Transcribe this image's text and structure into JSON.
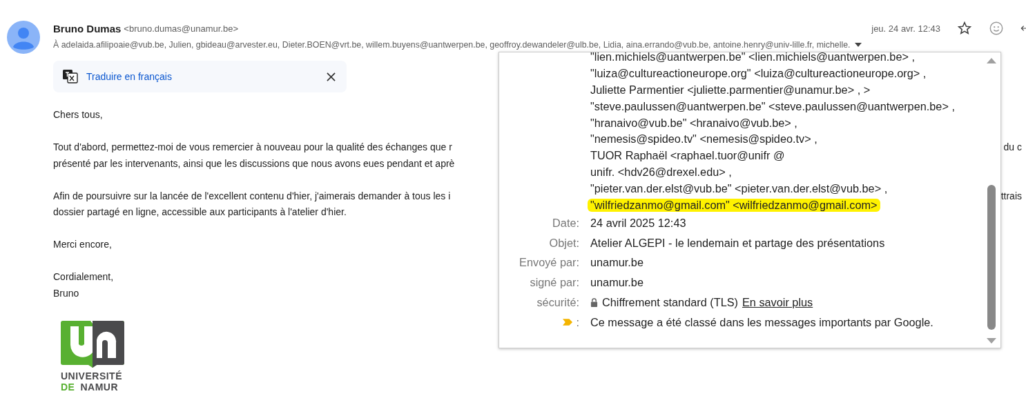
{
  "message": {
    "sender_name": "Bruno Dumas",
    "sender_email": "<bruno.dumas@unamur.be>",
    "date": "jeu. 24 avr. 12:43",
    "to_line": "À adelaida.afilipoaie@vub.be, Julien, gbideau@arvester.eu, Dieter.BOEN@vrt.be, willem.buyens@uantwerpen.be, geoffroy.dewandeler@ulb.be, Lidia, aina.errando@vub.be, antoine.henry@univ-lille.fr, michelle."
  },
  "translate_banner": {
    "label": "Traduire en français"
  },
  "body": [
    [
      {
        "text": "Chers tous,"
      }
    ],
    [
      {
        "text": "Tout d'abord, permettez-moi de vous remercier à nouveau pour la qualité des échanges que r",
        "tail": "du c"
      },
      {
        "text": "présenté par les intervenants, ainsi que les discussions que nous avons eues pendant et aprè"
      }
    ],
    [
      {
        "text": "Afin de poursuivre sur la lancée de l'excellent contenu d'hier, j'aimerais demander à tous les i",
        "tail": "ttrais"
      },
      {
        "text": "dossier partagé en ligne, accessible aux participants à l'atelier d'hier."
      }
    ],
    [
      {
        "text": "Merci encore,"
      }
    ],
    [
      {
        "text": "Cordialement,"
      },
      {
        "text": "Bruno"
      }
    ]
  ],
  "signature_logo": {
    "line1": "UNIVERSITÉ",
    "line2_left": "DE",
    "line2_right": "NAMUR"
  },
  "details_popup": {
    "recipients": [
      {
        "text": "\"lien.michiels@uantwerpen.be\" <lien.michiels@uantwerpen.be> ,",
        "highlighted": false
      },
      {
        "text": "\"luiza@cultureactioneurope.org\" <luiza@cultureactioneurope.org> ,",
        "highlighted": false
      },
      {
        "text": "Juliette Parmentier <juliette.parmentier@unamur.be> , >",
        "highlighted": false
      },
      {
        "text": "\"steve.paulussen@uantwerpen.be\" <steve.paulussen@uantwerpen.be> ,",
        "highlighted": false
      },
      {
        "text": "\"hranaivo@vub.be\" <hranaivo@vub.be> ,",
        "highlighted": false
      },
      {
        "text": "\"nemesis@spideo.tv\" <nemesis@spideo.tv> ,",
        "highlighted": false
      },
      {
        "text": "TUOR Raphaël <raphael.tuor@unifr @",
        "highlighted": false
      },
      {
        "text": "unifr. <hdv26@drexel.edu> ,",
        "highlighted": false
      },
      {
        "text": "\"pieter.van.der.elst@vub.be\" <pieter.van.der.elst@vub.be> ,",
        "highlighted": false
      },
      {
        "text": "\"wilfriedzanmo@gmail.com\" <wilfriedzanmo@gmail.com>",
        "highlighted": true
      }
    ],
    "fields": [
      {
        "kind": "text",
        "label": "Date:",
        "value": "24 avril 2025 12:43"
      },
      {
        "kind": "text",
        "label": "Objet:",
        "value": "Atelier ALGEPI - le lendemain et partage des présentations"
      },
      {
        "kind": "text",
        "label": "Envoyé par:",
        "value": "unamur.be"
      },
      {
        "kind": "text",
        "label": "signé par:",
        "value": "unamur.be"
      },
      {
        "kind": "security",
        "label": "sécurité:",
        "value": "Chiffrement standard (TLS)",
        "link": "En savoir plus"
      },
      {
        "kind": "importance",
        "label": ":",
        "value": "Ce message a été classé dans les messages importants par Google."
      }
    ]
  }
}
